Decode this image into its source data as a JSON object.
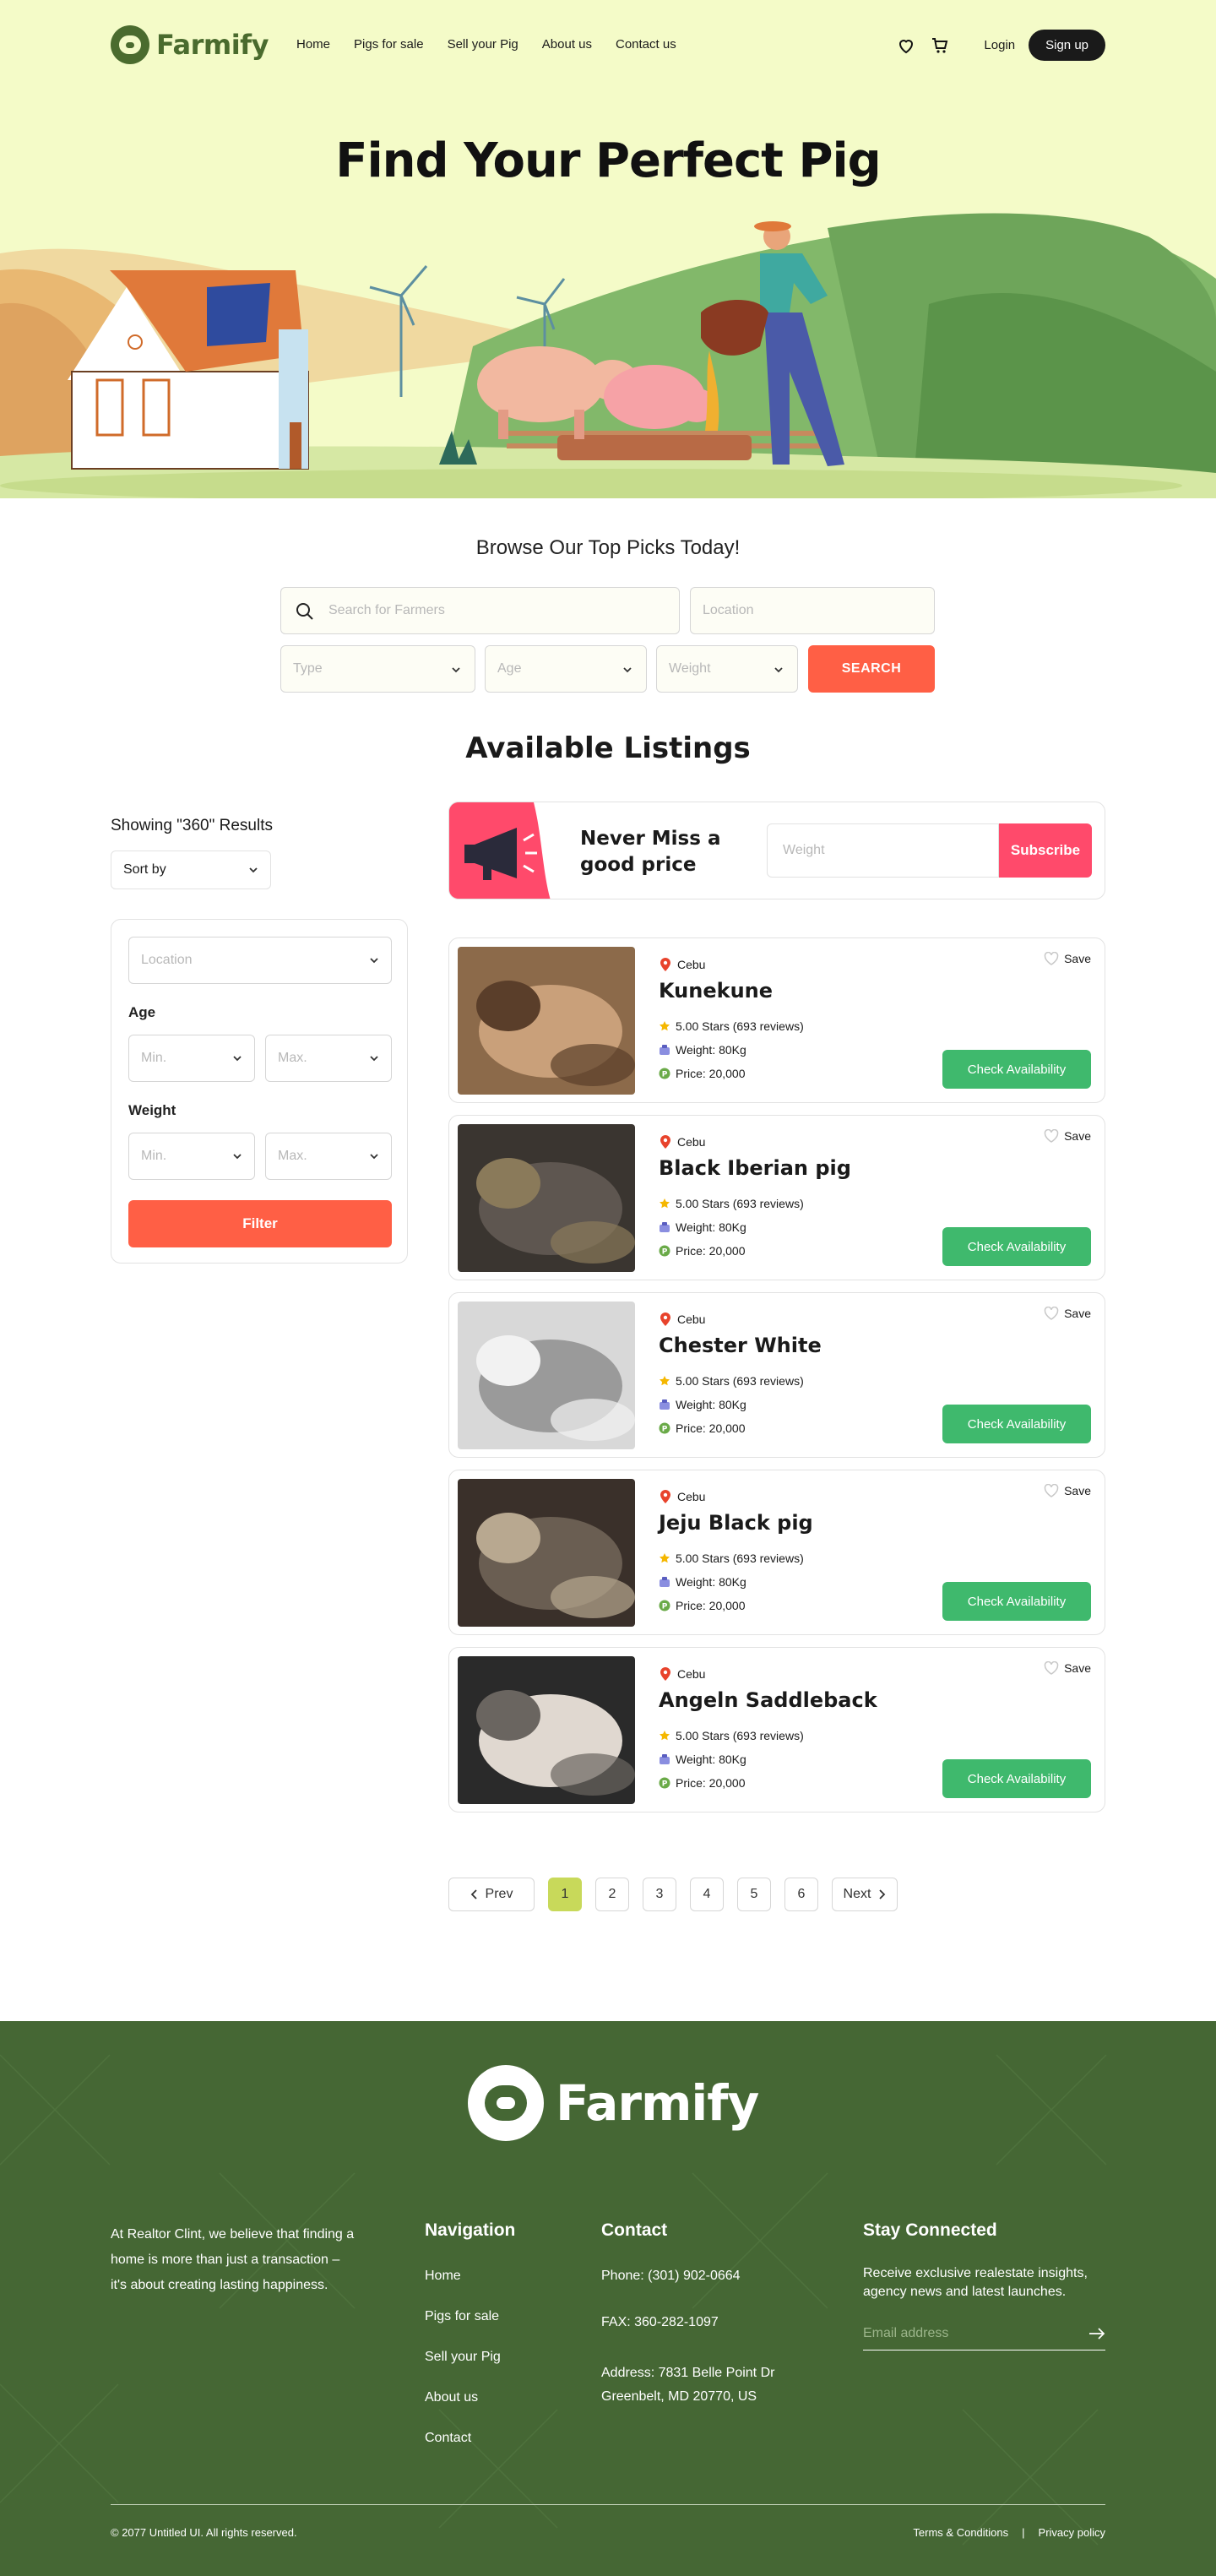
{
  "brand": {
    "name": "Farmify",
    "accent": "#4a6b2e",
    "cta": "#ff5f45",
    "success": "#3fb96d",
    "promo": "#ff4a6b",
    "footer_bg": "#456734"
  },
  "nav": {
    "items": [
      "Home",
      "Pigs for sale",
      "Sell your Pig",
      "About us",
      "Contact us"
    ],
    "wishlist_icon": "heart-icon",
    "cart_icon": "cart-icon",
    "login": "Login",
    "signup": "Sign up"
  },
  "hero": {
    "title": "Find Your Perfect Pig"
  },
  "search": {
    "heading": "Browse Our Top Picks Today!",
    "farmers_placeholder": "Search for Farmers",
    "location_placeholder": "Location",
    "type_placeholder": "Type",
    "age_placeholder": "Age",
    "weight_placeholder": "Weight",
    "button": "SEARCH"
  },
  "listings": {
    "heading": "Available Listings",
    "showing": "Showing \"360\" Results",
    "sort_label": "Sort by",
    "filters": {
      "location_placeholder": "Location",
      "age_label": "Age",
      "weight_label": "Weight",
      "min_placeholder": "Min.",
      "max_placeholder": "Max.",
      "button": "Filter"
    },
    "promo": {
      "text": "Never Miss a good price",
      "input_placeholder": "Weight",
      "button": "Subscribe"
    },
    "cards": [
      {
        "location": "Cebu",
        "name": "Kunekune",
        "rating": "5.00 Stars (693 reviews)",
        "weight": "Weight: 80Kg",
        "price": "Price: 20,000",
        "save": "Save",
        "action": "Check Availability"
      },
      {
        "location": "Cebu",
        "name": "Black Iberian pig",
        "rating": "5.00 Stars (693 reviews)",
        "weight": "Weight: 80Kg",
        "price": "Price: 20,000",
        "save": "Save",
        "action": "Check Availability"
      },
      {
        "location": "Cebu",
        "name": "Chester White",
        "rating": "5.00 Stars (693 reviews)",
        "weight": "Weight: 80Kg",
        "price": "Price: 20,000",
        "save": "Save",
        "action": "Check Availability"
      },
      {
        "location": "Cebu",
        "name": "Jeju Black pig",
        "rating": "5.00 Stars (693 reviews)",
        "weight": "Weight: 80Kg",
        "price": "Price: 20,000",
        "save": "Save",
        "action": "Check Availability"
      },
      {
        "location": "Cebu",
        "name": "Angeln Saddleback",
        "rating": "5.00 Stars (693 reviews)",
        "weight": "Weight: 80Kg",
        "price": "Price: 20,000",
        "save": "Save",
        "action": "Check Availability"
      }
    ]
  },
  "pagination": {
    "prev": "Prev",
    "next": "Next",
    "pages": [
      "1",
      "2",
      "3",
      "4",
      "5",
      "6"
    ],
    "current": "1"
  },
  "footer": {
    "brand": "Farmify",
    "about": "At Realtor Clint, we believe that finding a home is more than just a transaction – it's about creating lasting happiness.",
    "nav_heading": "Navigation",
    "nav_links": [
      "Home",
      "Pigs for sale",
      "Sell your Pig",
      "About us",
      "Contact"
    ],
    "contact_heading": "Contact",
    "phone": "Phone: (301) 902-0664",
    "fax": "FAX: 360-282-1097",
    "address": "Address: 7831 Belle Point Dr Greenbelt, MD 20770, US",
    "stay_heading": "Stay Connected",
    "stay_text": "Receive exclusive realestate insights, agency news and latest launches.",
    "email_placeholder": "Email address",
    "copyright": "© 2077 Untitled UI. All rights reserved.",
    "terms": "Terms & Conditions",
    "separator": "|",
    "privacy": "Privacy policy"
  }
}
